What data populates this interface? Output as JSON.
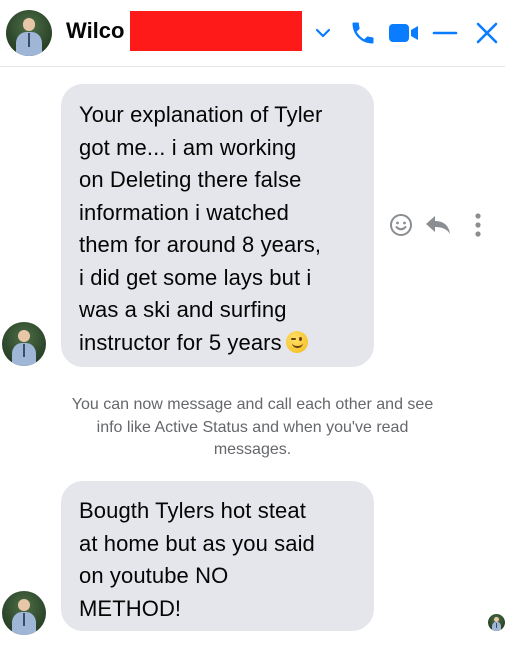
{
  "header": {
    "contact_name": "Wilco",
    "icons": [
      "avatar",
      "chevron-down-icon",
      "phone-icon",
      "video-icon",
      "minimize-icon",
      "close-icon"
    ],
    "accent_color": "#0a7cff",
    "redaction_color": "#ff1a1a"
  },
  "messages": [
    {
      "lines": [
        "Your explanation of Tyler",
        "got me... i am working",
        "on Deleting there false",
        "information i watched",
        "them for around 8 years,",
        "i did get some lays but i",
        "was a ski and surfing",
        "instructor for 5 years"
      ],
      "emoji": "winking-face-emoji"
    },
    {
      "lines": [
        "Bougth Tylers hot steat",
        "at home  but as you said",
        "on youtube NO",
        "METHOD!"
      ]
    }
  ],
  "message_actions": [
    "react-icon",
    "reply-icon",
    "more-icon"
  ],
  "system_message": {
    "lines": [
      "You can now message and call each other and see",
      "info like Active Status and when you've read",
      "messages."
    ]
  },
  "colors": {
    "bubble_bg": "#e4e6eb",
    "system_text": "#65676b",
    "action_icon": "#8a8d91"
  }
}
